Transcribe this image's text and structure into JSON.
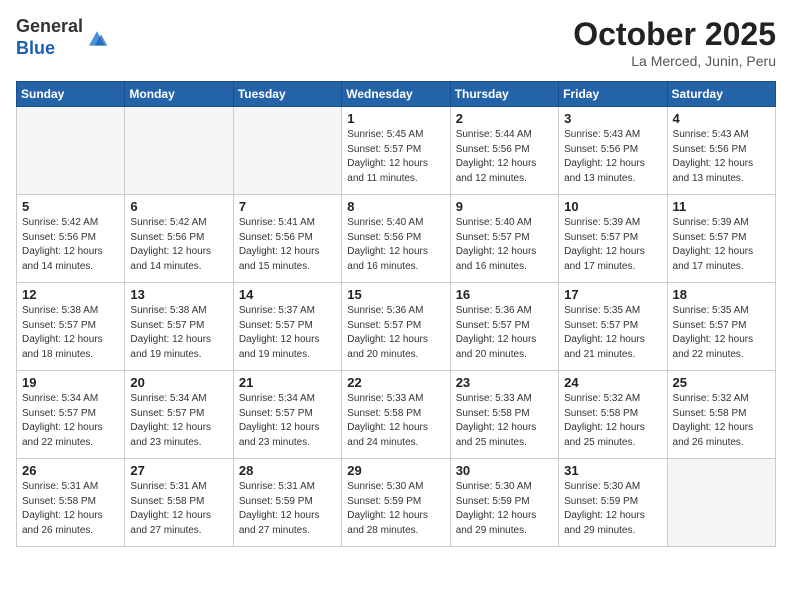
{
  "header": {
    "logo_line1": "General",
    "logo_line2": "Blue",
    "month": "October 2025",
    "location": "La Merced, Junin, Peru"
  },
  "weekdays": [
    "Sunday",
    "Monday",
    "Tuesday",
    "Wednesday",
    "Thursday",
    "Friday",
    "Saturday"
  ],
  "weeks": [
    [
      {
        "day": "",
        "info": ""
      },
      {
        "day": "",
        "info": ""
      },
      {
        "day": "",
        "info": ""
      },
      {
        "day": "1",
        "info": "Sunrise: 5:45 AM\nSunset: 5:57 PM\nDaylight: 12 hours\nand 11 minutes."
      },
      {
        "day": "2",
        "info": "Sunrise: 5:44 AM\nSunset: 5:56 PM\nDaylight: 12 hours\nand 12 minutes."
      },
      {
        "day": "3",
        "info": "Sunrise: 5:43 AM\nSunset: 5:56 PM\nDaylight: 12 hours\nand 13 minutes."
      },
      {
        "day": "4",
        "info": "Sunrise: 5:43 AM\nSunset: 5:56 PM\nDaylight: 12 hours\nand 13 minutes."
      }
    ],
    [
      {
        "day": "5",
        "info": "Sunrise: 5:42 AM\nSunset: 5:56 PM\nDaylight: 12 hours\nand 14 minutes."
      },
      {
        "day": "6",
        "info": "Sunrise: 5:42 AM\nSunset: 5:56 PM\nDaylight: 12 hours\nand 14 minutes."
      },
      {
        "day": "7",
        "info": "Sunrise: 5:41 AM\nSunset: 5:56 PM\nDaylight: 12 hours\nand 15 minutes."
      },
      {
        "day": "8",
        "info": "Sunrise: 5:40 AM\nSunset: 5:56 PM\nDaylight: 12 hours\nand 16 minutes."
      },
      {
        "day": "9",
        "info": "Sunrise: 5:40 AM\nSunset: 5:57 PM\nDaylight: 12 hours\nand 16 minutes."
      },
      {
        "day": "10",
        "info": "Sunrise: 5:39 AM\nSunset: 5:57 PM\nDaylight: 12 hours\nand 17 minutes."
      },
      {
        "day": "11",
        "info": "Sunrise: 5:39 AM\nSunset: 5:57 PM\nDaylight: 12 hours\nand 17 minutes."
      }
    ],
    [
      {
        "day": "12",
        "info": "Sunrise: 5:38 AM\nSunset: 5:57 PM\nDaylight: 12 hours\nand 18 minutes."
      },
      {
        "day": "13",
        "info": "Sunrise: 5:38 AM\nSunset: 5:57 PM\nDaylight: 12 hours\nand 19 minutes."
      },
      {
        "day": "14",
        "info": "Sunrise: 5:37 AM\nSunset: 5:57 PM\nDaylight: 12 hours\nand 19 minutes."
      },
      {
        "day": "15",
        "info": "Sunrise: 5:36 AM\nSunset: 5:57 PM\nDaylight: 12 hours\nand 20 minutes."
      },
      {
        "day": "16",
        "info": "Sunrise: 5:36 AM\nSunset: 5:57 PM\nDaylight: 12 hours\nand 20 minutes."
      },
      {
        "day": "17",
        "info": "Sunrise: 5:35 AM\nSunset: 5:57 PM\nDaylight: 12 hours\nand 21 minutes."
      },
      {
        "day": "18",
        "info": "Sunrise: 5:35 AM\nSunset: 5:57 PM\nDaylight: 12 hours\nand 22 minutes."
      }
    ],
    [
      {
        "day": "19",
        "info": "Sunrise: 5:34 AM\nSunset: 5:57 PM\nDaylight: 12 hours\nand 22 minutes."
      },
      {
        "day": "20",
        "info": "Sunrise: 5:34 AM\nSunset: 5:57 PM\nDaylight: 12 hours\nand 23 minutes."
      },
      {
        "day": "21",
        "info": "Sunrise: 5:34 AM\nSunset: 5:57 PM\nDaylight: 12 hours\nand 23 minutes."
      },
      {
        "day": "22",
        "info": "Sunrise: 5:33 AM\nSunset: 5:58 PM\nDaylight: 12 hours\nand 24 minutes."
      },
      {
        "day": "23",
        "info": "Sunrise: 5:33 AM\nSunset: 5:58 PM\nDaylight: 12 hours\nand 25 minutes."
      },
      {
        "day": "24",
        "info": "Sunrise: 5:32 AM\nSunset: 5:58 PM\nDaylight: 12 hours\nand 25 minutes."
      },
      {
        "day": "25",
        "info": "Sunrise: 5:32 AM\nSunset: 5:58 PM\nDaylight: 12 hours\nand 26 minutes."
      }
    ],
    [
      {
        "day": "26",
        "info": "Sunrise: 5:31 AM\nSunset: 5:58 PM\nDaylight: 12 hours\nand 26 minutes."
      },
      {
        "day": "27",
        "info": "Sunrise: 5:31 AM\nSunset: 5:58 PM\nDaylight: 12 hours\nand 27 minutes."
      },
      {
        "day": "28",
        "info": "Sunrise: 5:31 AM\nSunset: 5:59 PM\nDaylight: 12 hours\nand 27 minutes."
      },
      {
        "day": "29",
        "info": "Sunrise: 5:30 AM\nSunset: 5:59 PM\nDaylight: 12 hours\nand 28 minutes."
      },
      {
        "day": "30",
        "info": "Sunrise: 5:30 AM\nSunset: 5:59 PM\nDaylight: 12 hours\nand 29 minutes."
      },
      {
        "day": "31",
        "info": "Sunrise: 5:30 AM\nSunset: 5:59 PM\nDaylight: 12 hours\nand 29 minutes."
      },
      {
        "day": "",
        "info": ""
      }
    ]
  ]
}
